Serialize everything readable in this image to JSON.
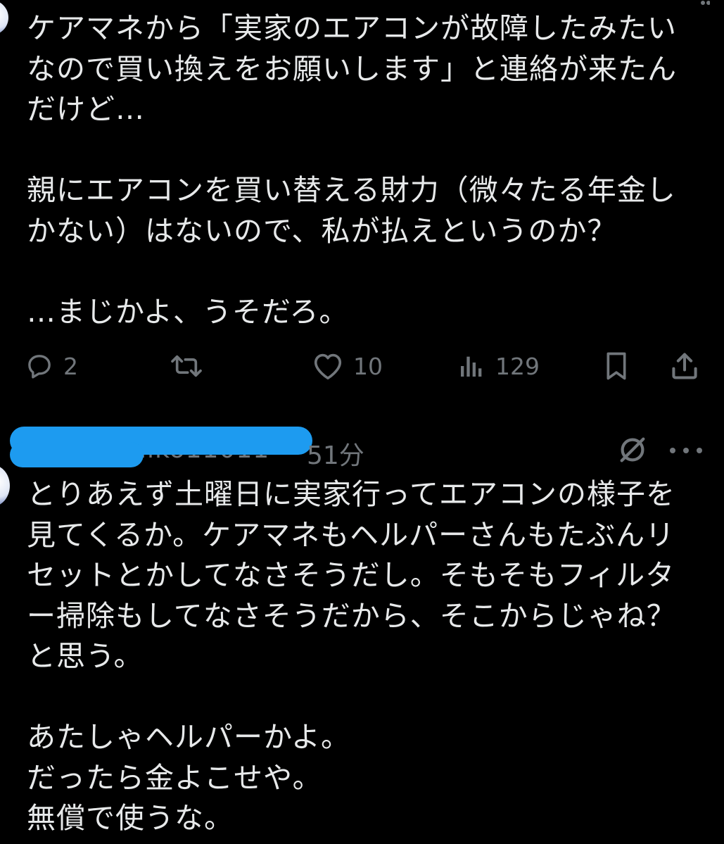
{
  "post1": {
    "lines": [
      "ケアマネから「実家のエアコンが故障したみたい",
      "なので買い換えをお願いします」と連絡が来たん",
      "だけど…",
      "",
      "親にエアコンを買い替える財力（微々たる年金し",
      "かない）はないので、私が払えというのか？",
      "",
      "…まじかよ、うそだろ。"
    ],
    "actions": {
      "reply_count": "2",
      "retweet_count": "",
      "like_count": "10",
      "views_count": "129"
    }
  },
  "post2": {
    "handle_visible": "aiko11011",
    "time": "51分",
    "lines": [
      "とりあえず土曜日に実家行ってエアコンの様子を",
      "見てくるか。ケアマネもヘルパーさんもたぶんリ",
      "セットとかしてなさそうだし。そもそもフィルタ",
      "ー掃除もしてなさそうだから、そこからじゃね？",
      "と思う。",
      "",
      "あたしゃヘルパーかよ。",
      "だったら金よこせや。",
      "無償で使うな。"
    ]
  },
  "icons": {
    "reply": "reply-icon",
    "retweet": "retweet-icon",
    "like": "heart-icon",
    "views": "views-icon",
    "bookmark": "bookmark-icon",
    "share": "share-icon",
    "grok": "grok-icon",
    "more": "more-icon"
  },
  "colors": {
    "background": "#000000",
    "text": "#e7e9ea",
    "muted": "#71767b",
    "redaction": "#1d9bf0"
  }
}
